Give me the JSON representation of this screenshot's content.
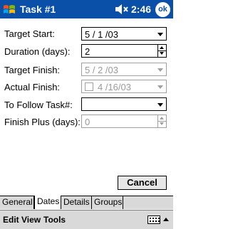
{
  "titlebar": {
    "title": "Task #1",
    "time": "2:46",
    "ok_label": "ok"
  },
  "form": {
    "target_start": {
      "label": "Target Start:",
      "value": "5 / 1 /03"
    },
    "duration": {
      "label": "Duration (days):",
      "value": "2"
    },
    "target_finish": {
      "label": "Target Finish:",
      "value": "5 / 2 /03"
    },
    "actual_finish": {
      "label": "Actual Finish:",
      "value": "4 /16/03",
      "checked": false
    },
    "to_follow": {
      "label": "To Follow Task#:",
      "value": ""
    },
    "finish_plus": {
      "label": "Finish Plus (days):",
      "value": "0"
    }
  },
  "buttons": {
    "cancel": "Cancel"
  },
  "tabs": [
    "General",
    "Dates",
    "Details",
    "Groups"
  ],
  "active_tab": "Dates",
  "menu": [
    "Edit",
    "View",
    "Tools"
  ],
  "icons": {
    "start": "windows-flag-icon",
    "volume": "volume-icon",
    "keyboard": "keyboard-icon"
  },
  "colors": {
    "titlebar": "#0a4fa8",
    "disabled_text": "#9a9a9a",
    "menubar": "#d9d9d9"
  }
}
